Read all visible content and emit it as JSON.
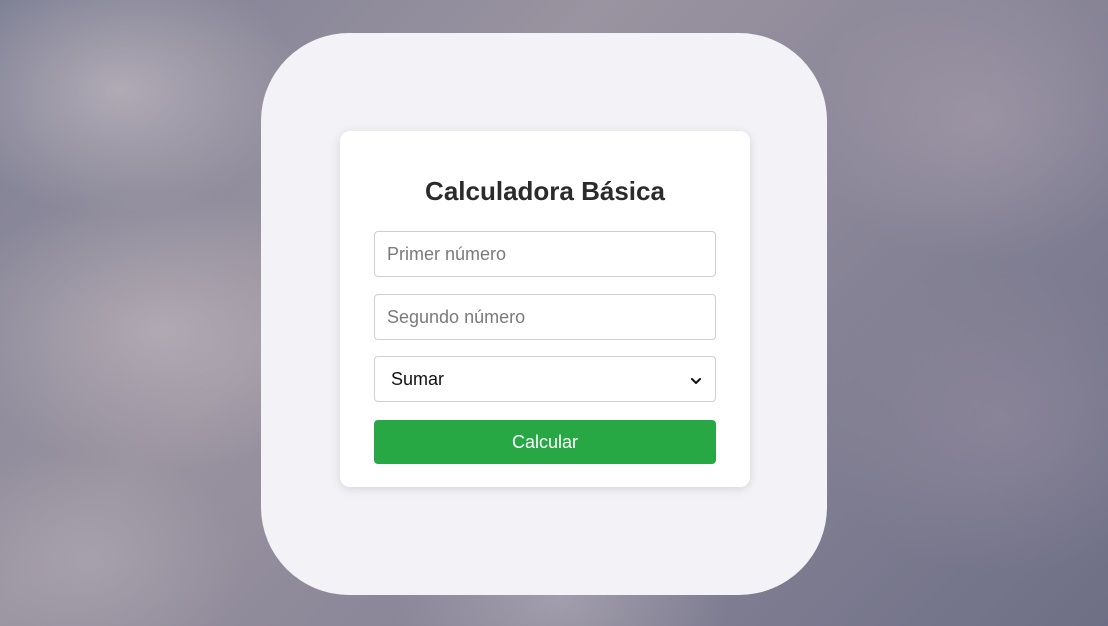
{
  "calculator": {
    "title": "Calculadora Básica",
    "first_input": {
      "placeholder": "Primer número",
      "value": ""
    },
    "second_input": {
      "placeholder": "Segundo número",
      "value": ""
    },
    "operation_select": {
      "selected": "Sumar"
    },
    "calculate_button": "Calcular"
  },
  "colors": {
    "button": "#28a745",
    "title": "#2b2b2b",
    "frame": "#f3f3f7",
    "card": "#ffffff"
  },
  "icons": {
    "select_arrow": "chevron-down-icon"
  }
}
